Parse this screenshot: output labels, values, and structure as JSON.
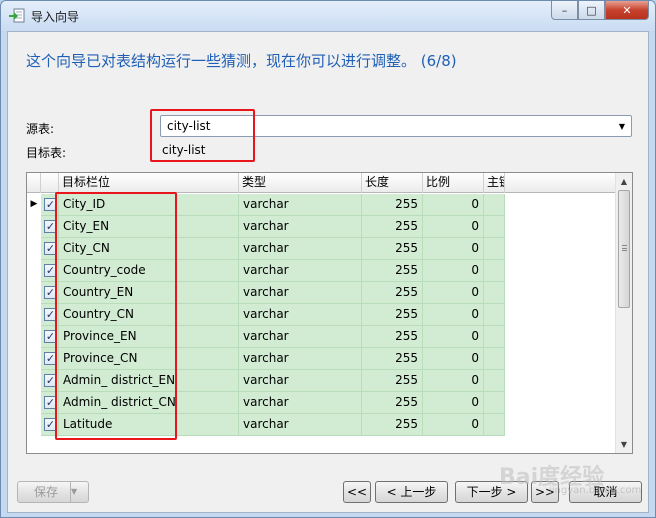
{
  "window": {
    "title": "导入向导",
    "minimize_glyph": "–",
    "maximize_glyph": "□",
    "close_glyph": "✕"
  },
  "wizard": {
    "heading": "这个向导已对表结构运行一些猜测，现在你可以进行调整。 (6/8)",
    "source_label": "源表:",
    "source_value": "city-list",
    "target_label": "目标表:",
    "target_value": "city-list"
  },
  "grid": {
    "columns": [
      "目标栏位",
      "类型",
      "长度",
      "比例",
      "主键"
    ],
    "current_row_marker": "▶",
    "check_glyph": "✓",
    "rows": [
      {
        "name": "City_ID",
        "type": "varchar",
        "length": "255",
        "scale": "0",
        "checked": true
      },
      {
        "name": "City_EN",
        "type": "varchar",
        "length": "255",
        "scale": "0",
        "checked": true
      },
      {
        "name": "City_CN",
        "type": "varchar",
        "length": "255",
        "scale": "0",
        "checked": true
      },
      {
        "name": "Country_code",
        "type": "varchar",
        "length": "255",
        "scale": "0",
        "checked": true
      },
      {
        "name": "Country_EN",
        "type": "varchar",
        "length": "255",
        "scale": "0",
        "checked": true
      },
      {
        "name": "Country_CN",
        "type": "varchar",
        "length": "255",
        "scale": "0",
        "checked": true
      },
      {
        "name": "Province_EN",
        "type": "varchar",
        "length": "255",
        "scale": "0",
        "checked": true
      },
      {
        "name": "Province_CN",
        "type": "varchar",
        "length": "255",
        "scale": "0",
        "checked": true
      },
      {
        "name": "Admin_ district_EN",
        "type": "varchar",
        "length": "255",
        "scale": "0",
        "checked": true
      },
      {
        "name": "Admin_ district_CN",
        "type": "varchar",
        "length": "255",
        "scale": "0",
        "checked": true
      },
      {
        "name": "Latitude",
        "type": "varchar",
        "length": "255",
        "scale": "0",
        "checked": true
      }
    ]
  },
  "buttons": {
    "save": "保存",
    "first": "<<",
    "prev": "< 上一步",
    "next": "下一步 >",
    "last": ">>",
    "cancel": "取消"
  },
  "watermark": {
    "main": "Bai度经验",
    "sub": "jingyan.baidu.com"
  },
  "colors": {
    "heading": "#1f5fb5",
    "row_fill": "#d2ecd3",
    "highlight_box": "#e8151b"
  }
}
